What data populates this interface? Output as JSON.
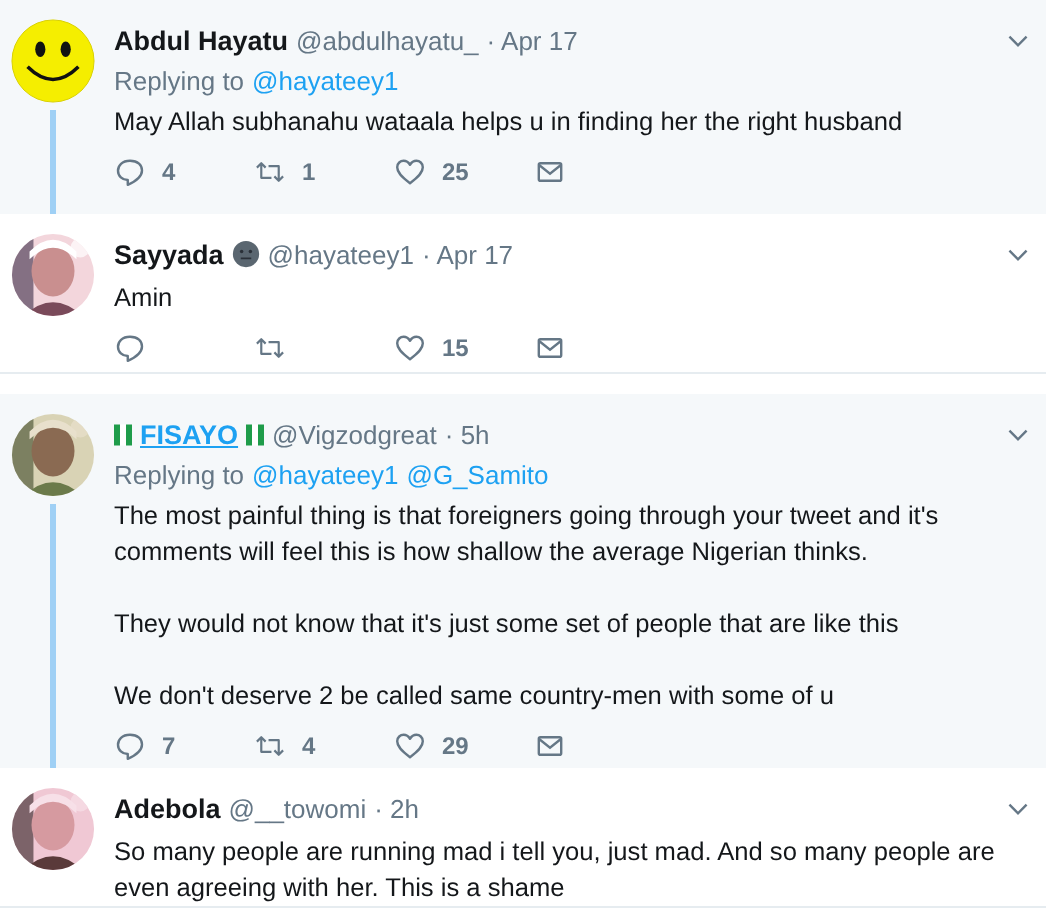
{
  "tweets": [
    {
      "highlighted": true,
      "thread_continues": true,
      "avatar": {
        "kind": "smiley"
      },
      "name": "Abdul Hayatu",
      "name_hovered": false,
      "flags": false,
      "emoji_after_name": false,
      "handle": "@abdulhayatu_",
      "date": "· Apr 17",
      "replying_label": "Replying to",
      "replying_to": [
        "@hayateey1"
      ],
      "body": [
        "May Allah subhanahu wataala helps u in finding her the right husband"
      ],
      "actions": [
        {
          "kind": "reply",
          "count": "4"
        },
        {
          "kind": "retweet",
          "count": "1"
        },
        {
          "kind": "like",
          "count": "25"
        },
        {
          "kind": "message"
        }
      ]
    },
    {
      "highlighted": false,
      "thread_continues": false,
      "avatar": {
        "kind": "picture"
      },
      "name": "Sayyada",
      "name_hovered": false,
      "flags": false,
      "emoji_after_name": true,
      "handle": "@hayateey1",
      "date": "· Apr 17",
      "body": [
        "Amin"
      ],
      "actions": [
        {
          "kind": "reply"
        },
        {
          "kind": "retweet"
        },
        {
          "kind": "like",
          "count": "15"
        },
        {
          "kind": "message"
        }
      ]
    },
    {
      "highlighted": true,
      "thread_continues": true,
      "avatar": {
        "kind": "picture"
      },
      "name": "FISAYO",
      "name_hovered": true,
      "flags": true,
      "emoji_after_name": false,
      "handle": "@Vigzodgreat",
      "date": "· 5h",
      "replying_label": "Replying to",
      "replying_to": [
        "@hayateey1",
        "@G_Samito"
      ],
      "body": [
        "The most painful thing is that foreigners going through your tweet and it's comments will feel this is how shallow the average Nigerian thinks.",
        "They would not know that it's just some set of people that are like this",
        "We don't deserve 2 be called same country-men with some of u"
      ],
      "actions": [
        {
          "kind": "reply",
          "count": "7"
        },
        {
          "kind": "retweet",
          "count": "4"
        },
        {
          "kind": "like",
          "count": "29"
        },
        {
          "kind": "message"
        }
      ]
    },
    {
      "highlighted": false,
      "thread_continues": false,
      "avatar": {
        "kind": "picture"
      },
      "name": "Adebola",
      "name_hovered": false,
      "flags": false,
      "emoji_after_name": false,
      "handle": "@__towomi",
      "date": "· 2h",
      "body": [
        "So many people are running mad i tell you, just mad. And so many people are even agreeing with her. This is a shame"
      ]
    }
  ]
}
